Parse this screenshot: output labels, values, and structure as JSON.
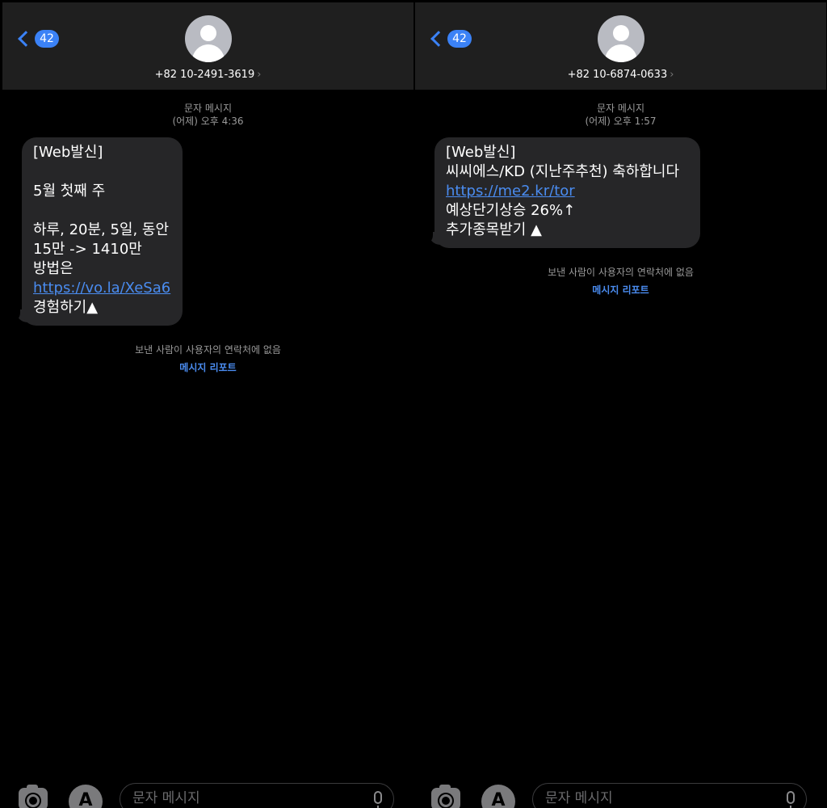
{
  "panels": [
    {
      "back_count": "42",
      "contact_number": "+82 10-2491-3619",
      "contact_arrow": "›",
      "message_type": "문자 메시지",
      "timestamp": "(어제) 오후 4:36",
      "lines": {
        "l1": "[Web발신]",
        "l2": "5월 첫째 주",
        "l3": "하루, 20분, 5일, 동안",
        "l4": "15만 -> 1410만",
        "l5": "방법은",
        "link": "https://vo.la/XeSa6",
        "l6": "경험하기▲"
      },
      "notice": "보낸 사람이 사용자의 연락처에 없음",
      "report_label": "메시지 리포트",
      "input_placeholder": "문자 메시지"
    },
    {
      "back_count": "42",
      "contact_number": "+82 10-6874-0633",
      "contact_arrow": "›",
      "message_type": "문자 메시지",
      "timestamp": "(어제) 오후 1:57",
      "lines": {
        "l1": "[Web발신]",
        "l2": "씨씨에스/KD (지난주추천) 축하합니다",
        "link": "https://me2.kr/tor",
        "l3": "예상단기상승 26%↑",
        "l4": "추가종목받기 ▲"
      },
      "notice": "보낸 사람이 사용자의 연락처에 없음",
      "report_label": "메시지 리포트",
      "input_placeholder": "문자 메시지"
    }
  ],
  "app_store_glyph": "A",
  "colors": {
    "accent": "#3b82f6",
    "link": "#4a8cf0",
    "bubble": "#262628",
    "header": "#1f1f1f"
  }
}
